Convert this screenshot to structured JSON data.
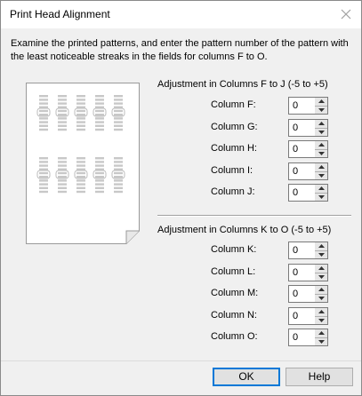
{
  "window": {
    "title": "Print Head Alignment",
    "close_icon": "close-icon"
  },
  "instructions": "Examine the printed patterns, and enter the pattern number of the pattern with the least noticeable streaks in the fields for columns F to O.",
  "group_fj": {
    "title": "Adjustment in Columns F to J (-5 to +5)",
    "rows": [
      {
        "label": "Column F:",
        "value": "0"
      },
      {
        "label": "Column G:",
        "value": "0"
      },
      {
        "label": "Column H:",
        "value": "0"
      },
      {
        "label": "Column I:",
        "value": "0"
      },
      {
        "label": "Column J:",
        "value": "0"
      }
    ]
  },
  "group_ko": {
    "title": "Adjustment in Columns K to O (-5 to +5)",
    "rows": [
      {
        "label": "Column K:",
        "value": "0"
      },
      {
        "label": "Column L:",
        "value": "0"
      },
      {
        "label": "Column M:",
        "value": "0"
      },
      {
        "label": "Column N:",
        "value": "0"
      },
      {
        "label": "Column O:",
        "value": "0"
      }
    ]
  },
  "buttons": {
    "ok": "OK",
    "help": "Help"
  },
  "colors": {
    "accent": "#0078d7",
    "dialog_bg": "#f0f0f0"
  }
}
